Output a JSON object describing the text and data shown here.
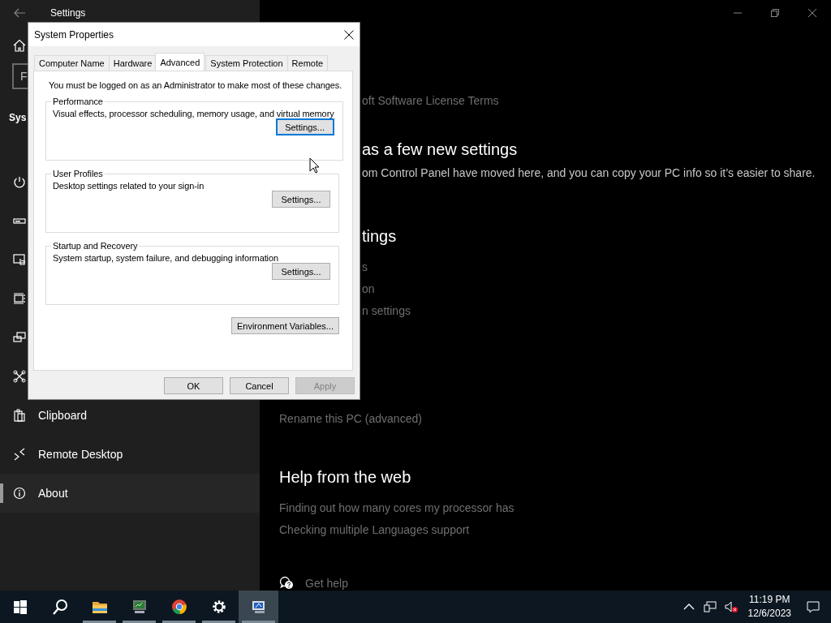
{
  "settings_window": {
    "title": "Settings",
    "search": {
      "placeholder": "F"
    },
    "heading": "Sys",
    "sidebar": {
      "items": [
        {
          "selected": false
        },
        {
          "selected": false
        },
        {
          "selected": false
        },
        {
          "selected": false
        },
        {
          "selected": false
        },
        {
          "selected": false
        },
        {
          "label": "Clipboard",
          "selected": false
        },
        {
          "label": "Remote Desktop",
          "selected": false
        },
        {
          "label": "About",
          "selected": true
        }
      ]
    },
    "content": {
      "beside_dialog": [
        {
          "kind": "link",
          "text": "oft Software License Terms"
        },
        {
          "kind": "heading",
          "text": "as a few new settings"
        },
        {
          "kind": "text",
          "text": "om Control Panel have moved here, and you can copy your PC info so it’s easier to share."
        },
        {
          "kind": "heading",
          "text": "tings"
        },
        {
          "kind": "link",
          "text": "s"
        },
        {
          "kind": "link",
          "text": "on"
        },
        {
          "kind": "link",
          "text": "n settings"
        }
      ],
      "below_dialog": [
        {
          "kind": "link",
          "text": "Rename this PC (advanced)"
        },
        {
          "kind": "heading",
          "text": "Help from the web"
        },
        {
          "kind": "link",
          "text": "Finding out how many cores my processor has"
        },
        {
          "kind": "link",
          "text": "Checking multiple Languages support"
        },
        {
          "kind": "help",
          "text": "Get help"
        }
      ]
    }
  },
  "dialog": {
    "title": "System Properties",
    "tabs": [
      {
        "label": "Computer Name",
        "selected": false
      },
      {
        "label": "Hardware",
        "selected": false
      },
      {
        "label": "Advanced",
        "selected": true
      },
      {
        "label": "System Protection",
        "selected": false
      },
      {
        "label": "Remote",
        "selected": false
      }
    ],
    "notice": "You must be logged on as an Administrator to make most of these changes.",
    "groups": [
      {
        "title": "Performance",
        "description": "Visual effects, processor scheduling, memory usage, and virtual memory",
        "button": {
          "label": "Settings...",
          "focused": true
        }
      },
      {
        "title": "User Profiles",
        "description": "Desktop settings related to your sign-in",
        "button": {
          "label": "Settings...",
          "focused": false
        }
      },
      {
        "title": "Startup and Recovery",
        "description": "System startup, system failure, and debugging information",
        "button": {
          "label": "Settings...",
          "focused": false
        }
      }
    ],
    "extra_button": {
      "label": "Environment Variables..."
    },
    "buttons": [
      {
        "label": "OK",
        "disabled": false
      },
      {
        "label": "Cancel",
        "disabled": false
      },
      {
        "label": "Apply",
        "disabled": true
      }
    ]
  },
  "taskbar": {
    "buttons": [
      {
        "running": false,
        "active": false
      },
      {
        "running": false,
        "active": false
      },
      {
        "running": true,
        "active": false
      },
      {
        "running": true,
        "active": false
      },
      {
        "running": true,
        "active": false
      },
      {
        "running": true,
        "active": false
      },
      {
        "running": true,
        "active": true
      }
    ],
    "tray": {
      "volume_muted": true
    },
    "clock": {
      "time": "11:19 PM",
      "date": "12/6/2023"
    }
  }
}
